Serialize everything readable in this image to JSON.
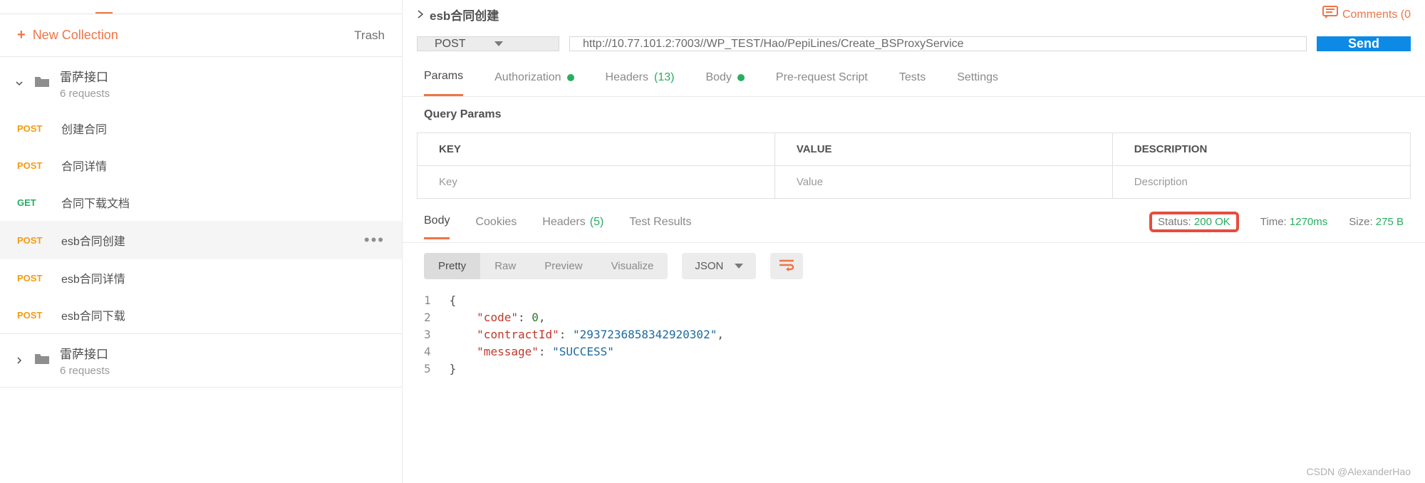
{
  "sidebar": {
    "new_collection": "New Collection",
    "trash": "Trash",
    "collections": [
      {
        "name": "雷萨接口",
        "sub": "6 requests",
        "expanded": true,
        "items": [
          {
            "method": "POST",
            "name": "创建合同"
          },
          {
            "method": "POST",
            "name": "合同详情"
          },
          {
            "method": "GET",
            "name": "合同下载文档"
          },
          {
            "method": "POST",
            "name": "esb合同创建",
            "selected": true
          },
          {
            "method": "POST",
            "name": "esb合同详情"
          },
          {
            "method": "POST",
            "name": "esb合同下载"
          }
        ]
      },
      {
        "name": "雷萨接口",
        "sub": "6 requests",
        "expanded": false
      }
    ]
  },
  "header": {
    "tab_title": "esb合同创建",
    "comments": "Comments (0"
  },
  "request": {
    "method": "POST",
    "url": "http://10.77.101.2:7003//WP_TEST/Hao/PepiLines/Create_BSProxyService",
    "send": "Send",
    "tabs": {
      "params": "Params",
      "authorization": "Authorization",
      "headers_label": "Headers",
      "headers_count": "(13)",
      "body": "Body",
      "prerequest": "Pre-request Script",
      "tests": "Tests",
      "settings": "Settings"
    },
    "query_params_label": "Query Params",
    "table": {
      "key": "KEY",
      "value": "VALUE",
      "description": "DESCRIPTION",
      "ph_key": "Key",
      "ph_value": "Value",
      "ph_desc": "Description"
    }
  },
  "response": {
    "tabs": {
      "body": "Body",
      "cookies": "Cookies",
      "headers_label": "Headers",
      "headers_count": "(5)",
      "test_results": "Test Results"
    },
    "meta": {
      "status_label": "Status:",
      "status_value": "200 OK",
      "time_label": "Time:",
      "time_value": "1270ms",
      "size_label": "Size:",
      "size_value": "275 B"
    },
    "toolbar": {
      "pretty": "Pretty",
      "raw": "Raw",
      "preview": "Preview",
      "visualize": "Visualize",
      "json": "JSON"
    },
    "body_json": {
      "code": 0,
      "contractId": "2937236858342920302",
      "message": "SUCCESS"
    },
    "lines": [
      "1",
      "2",
      "3",
      "4",
      "5"
    ]
  },
  "watermark": "CSDN @AlexanderHao"
}
